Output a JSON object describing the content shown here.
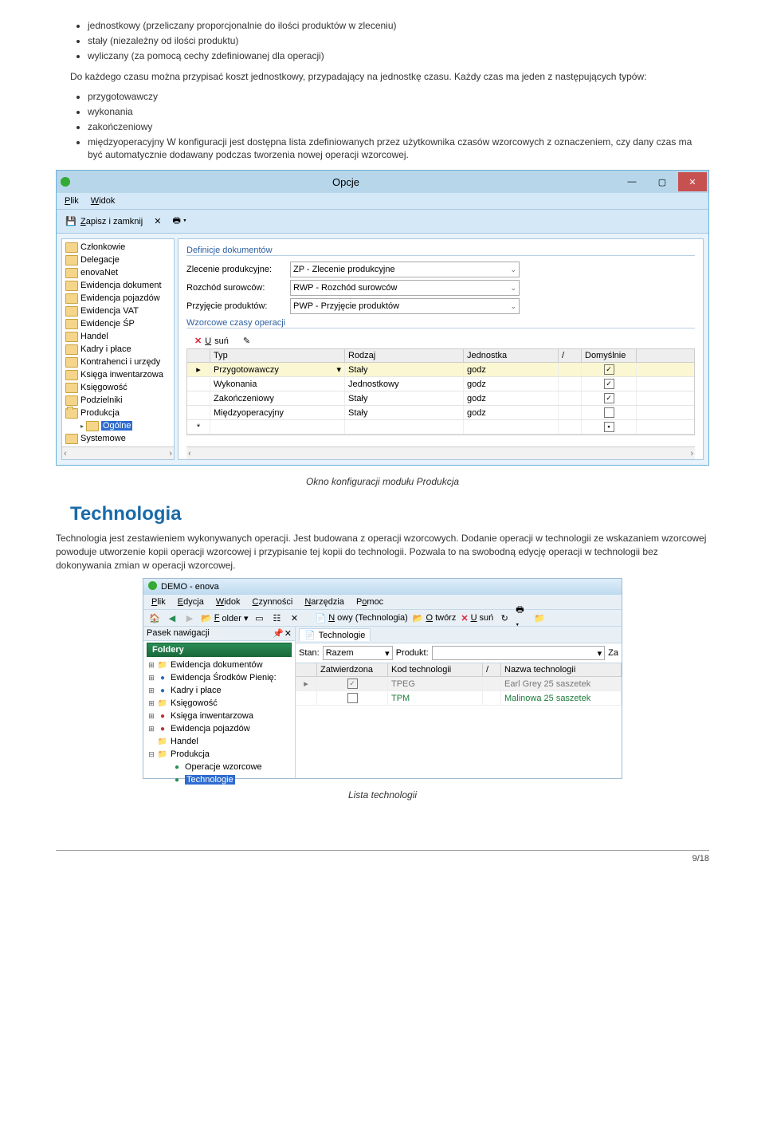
{
  "para_intro_list": [
    "jednostkowy (przeliczany proporcjonalnie do ilości produktów w zleceniu)",
    "stały (niezależny od ilości produktu)",
    "wyliczany (za pomocą cechy zdefiniowanej dla operacji)"
  ],
  "para_after_list1": "Do każdego czasu można przypisać koszt jednostkowy, przypadający na jednostkę czasu. Każdy czas ma jeden z następujących typów:",
  "list2": [
    "przygotowawczy",
    "wykonania",
    "zakończeniowy"
  ],
  "list2_last": "międzyoperacyjny W konfiguracji jest dostępna lista zdefiniowanych przez użytkownika czasów wzorcowych z oznaczeniem, czy dany czas ma być automatycznie dodawany podczas tworzenia nowej operacji wzorcowej.",
  "caption1": "Okno konfiguracji modułu Produkcja",
  "section_heading": "Technologia",
  "section_para": "Technologia jest zestawieniem wykonywanych operacji. Jest budowana z operacji wzorcowych. Dodanie operacji w technologii ze wskazaniem wzorcowej powoduje utworzenie kopii operacji wzorcowej i przypisanie tej kopii do technologii. Pozwala to na swobodną edycję operacji w technologii bez dokonywania zmian w operacji wzorcowej.",
  "caption2": "Lista technologii",
  "page_number": "9/18",
  "win1": {
    "title": "Opcje",
    "menu": {
      "plik": "Plik",
      "widok": "Widok"
    },
    "toolbar": {
      "zapisz": "Zapisz i zamknij"
    },
    "tree": [
      {
        "label": "Członkowie"
      },
      {
        "label": "Delegacje"
      },
      {
        "label": "enovaNet"
      },
      {
        "label": "Ewidencja dokument"
      },
      {
        "label": "Ewidencja pojazdów"
      },
      {
        "label": "Ewidencja VAT"
      },
      {
        "label": "Ewidencje ŚP"
      },
      {
        "label": "Handel"
      },
      {
        "label": "Kadry i płace"
      },
      {
        "label": "Kontrahenci i urzędy"
      },
      {
        "label": "Księga inwentarzowa"
      },
      {
        "label": "Księgowość"
      },
      {
        "label": "Podzielniki"
      },
      {
        "label": "Produkcja",
        "open": true
      },
      {
        "label": "Ogólne",
        "sub": true,
        "sel": true
      },
      {
        "label": "Systemowe"
      }
    ],
    "group1": "Definicje dokumentów",
    "defs": [
      {
        "lab": "Zlecenie produkcyjne:",
        "val": "ZP - Zlecenie produkcyjne"
      },
      {
        "lab": "Rozchód surowców:",
        "val": "RWP - Rozchód surowców"
      },
      {
        "lab": "Przyjęcie produktów:",
        "val": "PWP - Przyjęcie produktów"
      }
    ],
    "group2": "Wzorcowe czasy operacji",
    "usun": "Usuń",
    "gridhead": {
      "typ": "Typ",
      "rodzaj": "Rodzaj",
      "jedn": "Jednostka",
      "dom": "Domyślnie"
    },
    "rows": [
      {
        "typ": "Przygotowawczy",
        "rodzaj": "Stały",
        "jedn": "godz",
        "chk": true,
        "sel": true,
        "mark": "▸"
      },
      {
        "typ": "Wykonania",
        "rodzaj": "Jednostkowy",
        "jedn": "godz",
        "chk": true
      },
      {
        "typ": "Zakończeniowy",
        "rodzaj": "Stały",
        "jedn": "godz",
        "chk": true
      },
      {
        "typ": "Międzyoperacyjny",
        "rodzaj": "Stały",
        "jedn": "godz",
        "chk": false
      }
    ]
  },
  "win2": {
    "title": "DEMO - enova",
    "menu": {
      "plik": "Plik",
      "edycja": "Edycja",
      "widok": "Widok",
      "czyn": "Czynności",
      "narz": "Narzędzia",
      "pomoc": "Pomoc"
    },
    "tb": {
      "folder": "Folder",
      "nowy": "Nowy (Technologia)",
      "otworz": "Otwórz",
      "usun": "Usuń"
    },
    "nav_label": "Pasek nawigacji",
    "fold_label": "Foldery",
    "tree": [
      {
        "exp": "⊞",
        "ico": "fld",
        "label": "Ewidencja dokumentów"
      },
      {
        "exp": "⊞",
        "ico": "blue",
        "label": "Ewidencja Środków Pienię:"
      },
      {
        "exp": "⊞",
        "ico": "blue",
        "label": "Kadry i płace"
      },
      {
        "exp": "⊞",
        "ico": "fld",
        "label": "Księgowość"
      },
      {
        "exp": "⊞",
        "ico": "red",
        "label": "Księga inwentarzowa"
      },
      {
        "exp": "⊞",
        "ico": "red",
        "label": "Ewidencja pojazdów"
      },
      {
        "exp": "",
        "ico": "fld",
        "label": "Handel"
      },
      {
        "exp": "⊟",
        "ico": "fld",
        "label": "Produkcja"
      },
      {
        "exp": "",
        "ico": "green",
        "label": "Operacje wzorcowe",
        "sub": true
      },
      {
        "exp": "",
        "ico": "green",
        "label": "Technologie",
        "sub": true,
        "sel": true
      }
    ],
    "tab": "Technologie",
    "filter": {
      "stan": "Stan:",
      "stan_v": "Razem",
      "prod": "Produkt:",
      "za": "Za"
    },
    "ghead": {
      "zat": "Zatwierdzona",
      "kod": "Kod technologii",
      "naz": "Nazwa technologii"
    },
    "rows": [
      {
        "sel": true,
        "mark": "▸",
        "chk": true,
        "kod": "TPEG",
        "naz": "Earl Grey 25 saszetek"
      },
      {
        "chk": false,
        "kod": "TPM",
        "naz": "Malinowa 25 saszetek"
      }
    ]
  }
}
